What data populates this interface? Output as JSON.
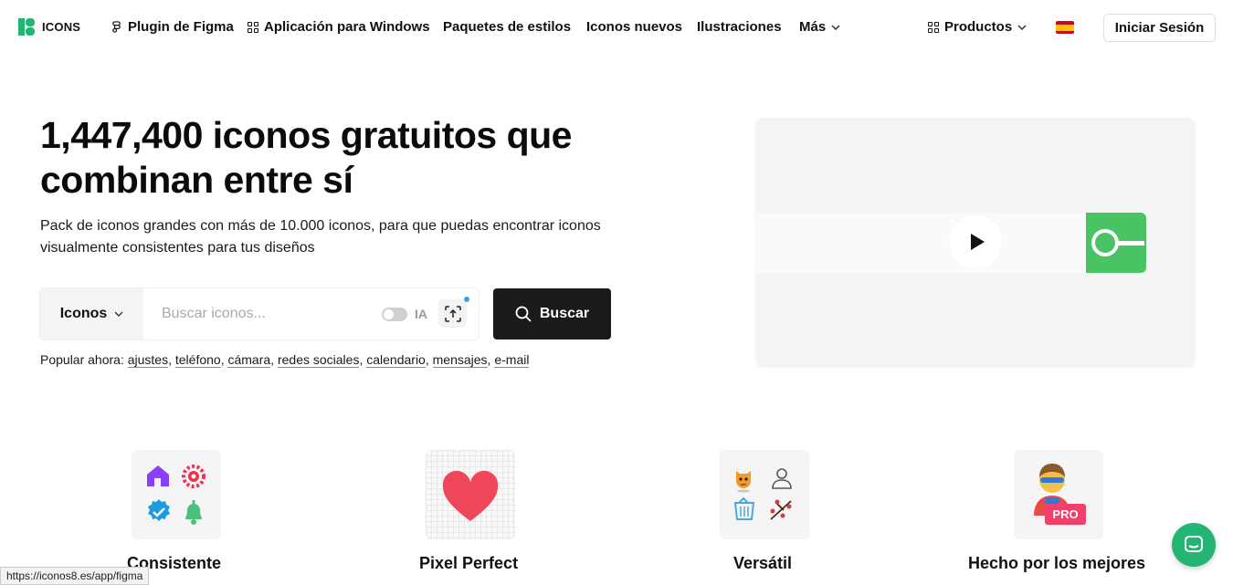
{
  "nav": {
    "logo_text": "ICONS",
    "items": [
      {
        "label": "Plugin de Figma"
      },
      {
        "label": "Aplicación para Windows"
      },
      {
        "label": "Paquetes de estilos"
      },
      {
        "label": "Iconos nuevos"
      },
      {
        "label": "Ilustraciones"
      },
      {
        "label": "Más"
      }
    ],
    "products_label": "Productos",
    "login_label": "Iniciar Sesión"
  },
  "hero": {
    "title": "1,447,400 iconos gratuitos que combinan entre sí",
    "subtitle": "Pack de iconos grandes con más de 10.000 iconos, para que puedas encontrar iconos visualmente consistentes para tus diseños"
  },
  "search": {
    "type_label": "Iconos",
    "placeholder": "Buscar iconos...",
    "ia_label": "IA",
    "button_label": "Buscar"
  },
  "popular": {
    "prefix": "Popular ahora:",
    "tags": [
      "ajustes",
      "teléfono",
      "cámara",
      "redes sociales",
      "calendario",
      "mensajes",
      "e-mail"
    ]
  },
  "features": [
    {
      "title": "Consistente"
    },
    {
      "title": "Pixel Perfect"
    },
    {
      "title": "Versátil"
    },
    {
      "title": "Hecho por los mejores",
      "badge": "PRO"
    }
  ],
  "status_url": "https://iconos8.es/app/figma",
  "colors": {
    "brand_green": "#22b573",
    "button_dark": "#1a1a1a",
    "pro_badge": "#f0406b",
    "heart_red": "#f0465a",
    "purple": "#8a3ffc",
    "icon_red": "#e8344f",
    "blue": "#1e9ae0",
    "green": "#4cc07a"
  }
}
